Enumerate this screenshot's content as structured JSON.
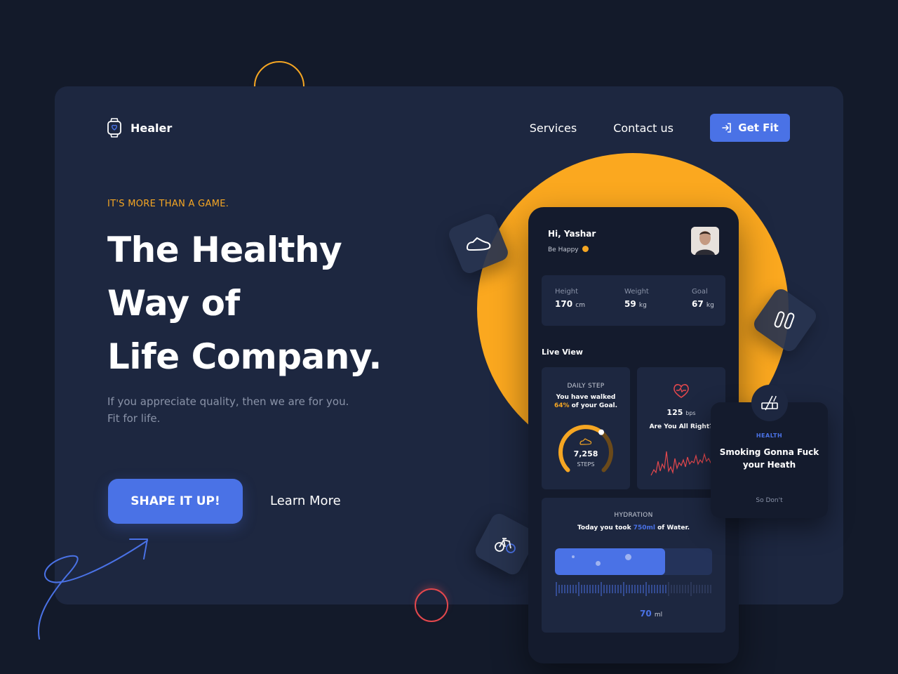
{
  "brand": {
    "name": "Healer"
  },
  "nav": {
    "services": "Services",
    "contact": "Contact us",
    "cta": "Get Fit"
  },
  "hero": {
    "eyebrow": "IT'S MORE THAN A GAME.",
    "line1": "The Healthy",
    "line2": "Way of",
    "line3": "Life Company.",
    "sub1": "If you appreciate quality, then we are for you.",
    "sub2": "Fit for life.",
    "primary_btn": "SHAPE IT UP!",
    "secondary_btn": "Learn More"
  },
  "app": {
    "greeting": "Hi, Yashar",
    "mood": "Be Happy",
    "stats": [
      {
        "label": "Height",
        "value": "170",
        "unit": "cm"
      },
      {
        "label": "Weight",
        "value": "59",
        "unit": "kg"
      },
      {
        "label": "Goal",
        "value": "67",
        "unit": "kg"
      }
    ],
    "live_view": "Live View",
    "daily": {
      "caption": "DAILY STEP",
      "line1": "You have walked",
      "percent": "64%",
      "line2_rest": "of your Goal.",
      "steps": "7,258",
      "steps_label": "STEPS",
      "progress": 0.64
    },
    "heart": {
      "value": "125",
      "unit": "bps",
      "question": "Are You All Right?"
    },
    "hydration": {
      "caption": "HYDRATION",
      "text_pre": "Today you took",
      "amount": "750ml",
      "text_post": "of Water.",
      "level": "70",
      "level_unit": "ml"
    }
  },
  "side_card": {
    "tag": "HEALTH",
    "title1": "Smoking Gonna Fuck",
    "title2": "your Heath",
    "action": "So Don't"
  },
  "colors": {
    "background": "#131a2a",
    "card": "#1d2740",
    "accent_blue": "#4a72e6",
    "accent_orange": "#fba81f",
    "heart_red": "#e5484d"
  }
}
